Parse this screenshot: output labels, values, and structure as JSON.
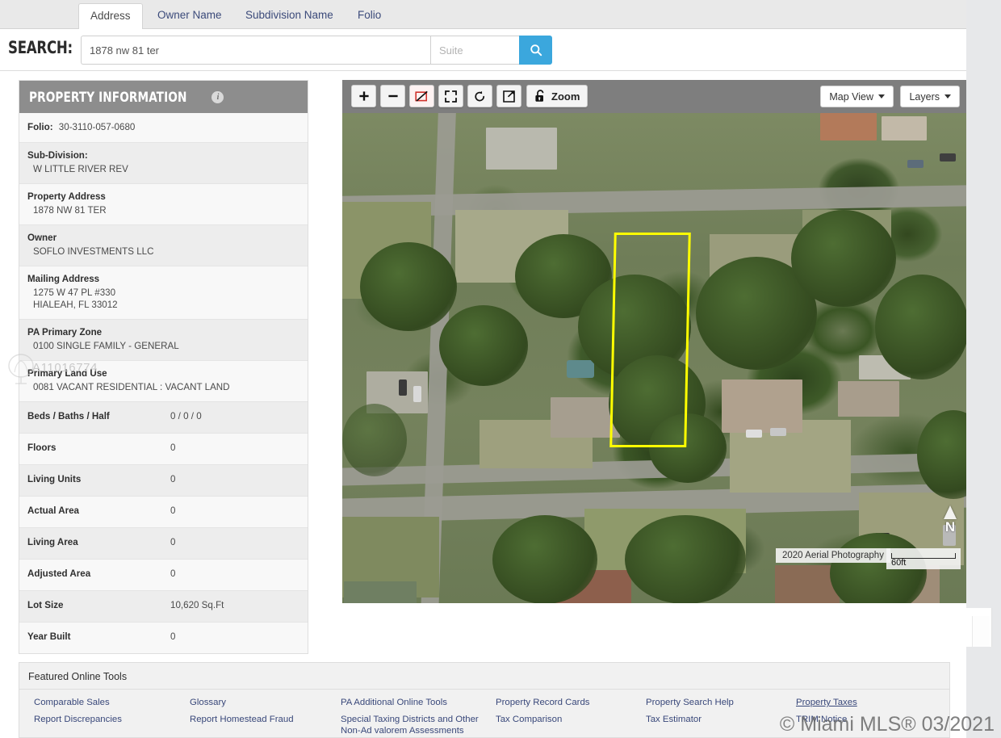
{
  "tabs": [
    {
      "label": "Address",
      "active": true
    },
    {
      "label": "Owner Name",
      "active": false
    },
    {
      "label": "Subdivision Name",
      "active": false
    },
    {
      "label": "Folio",
      "active": false
    }
  ],
  "search": {
    "label": "SEARCH:",
    "value": "1878 nw 81 ter",
    "placeholder": "",
    "suite_value": "",
    "suite_placeholder": "Suite",
    "button_icon": "search-icon"
  },
  "property_information": {
    "title": "PROPERTY INFORMATION",
    "info_icon": "info-icon",
    "rows": [
      {
        "label": "Folio:",
        "value": "30-3110-057-0680",
        "style": "inline-compact"
      },
      {
        "label": "Sub-Division:",
        "value": "W LITTLE RIVER REV",
        "style": "stack"
      },
      {
        "label": "Property Address",
        "value": "1878 NW 81 TER",
        "style": "stack"
      },
      {
        "label": "Owner",
        "value": "SOFLO INVESTMENTS LLC",
        "style": "stack"
      },
      {
        "label": "Mailing Address",
        "value": "1275 W 47 PL #330\nHIALEAH, FL 33012",
        "style": "stack2"
      },
      {
        "label": "PA Primary Zone",
        "value": "0100 SINGLE FAMILY - GENERAL",
        "style": "stack"
      },
      {
        "label": "Primary Land Use",
        "value": "0081 VACANT RESIDENTIAL : VACANT LAND",
        "style": "stack"
      },
      {
        "label": "Beds / Baths / Half",
        "value": "0 / 0 / 0",
        "style": "inline"
      },
      {
        "label": "Floors",
        "value": "0",
        "style": "inline"
      },
      {
        "label": "Living Units",
        "value": "0",
        "style": "inline"
      },
      {
        "label": "Actual Area",
        "value": "0",
        "style": "inline"
      },
      {
        "label": "Living Area",
        "value": "0",
        "style": "inline"
      },
      {
        "label": "Adjusted Area",
        "value": "0",
        "style": "inline"
      },
      {
        "label": "Lot Size",
        "value": "10,620 Sq.Ft",
        "style": "inline"
      },
      {
        "label": "Year Built",
        "value": "0",
        "style": "inline"
      }
    ]
  },
  "map": {
    "toolbar": [
      {
        "name": "zoom-in-button",
        "glyph": "+"
      },
      {
        "name": "zoom-out-button",
        "glyph": "−"
      },
      {
        "name": "clear-selection-button",
        "glyph": ""
      },
      {
        "name": "full-extent-button",
        "glyph": ""
      },
      {
        "name": "refresh-button",
        "glyph": ""
      },
      {
        "name": "popout-button",
        "glyph": ""
      },
      {
        "name": "zoom-lock-button",
        "glyph": "",
        "label": "Zoom"
      }
    ],
    "zoom_label": "Zoom",
    "map_view_label": "Map View",
    "layers_label": "Layers",
    "aerial_label": "2020 Aerial Photography",
    "scale_label": "60ft",
    "north_label": "N",
    "parcel_outline_color": "#ffff00"
  },
  "tools": {
    "title": "Featured Online Tools",
    "links": [
      {
        "label": "Comparable Sales",
        "underline": false
      },
      {
        "label": "Glossary",
        "underline": false
      },
      {
        "label": "PA Additional Online Tools",
        "underline": false
      },
      {
        "label": "Property Record Cards",
        "underline": false
      },
      {
        "label": "Property Search Help",
        "underline": false
      },
      {
        "label": "Property Taxes",
        "underline": true
      },
      {
        "label": "Report Discrepancies",
        "underline": false
      },
      {
        "label": "Report Homestead Fraud",
        "underline": false
      },
      {
        "label": "Special Taxing Districts and Other Non-Ad valorem Assessments",
        "underline": false
      },
      {
        "label": "Tax Comparison",
        "underline": false
      },
      {
        "label": "Tax Estimator",
        "underline": false
      },
      {
        "label": "TRIM Notice",
        "underline": false
      }
    ]
  },
  "watermarks": {
    "listing_id": "A11016774",
    "mls": "© Miami MLS® 03/2021"
  },
  "colors": {
    "accent_blue": "#3ba7dd",
    "link_blue": "#39487a",
    "panel_header_gray": "#8d8d8d",
    "parcel_yellow": "#ffff00"
  }
}
